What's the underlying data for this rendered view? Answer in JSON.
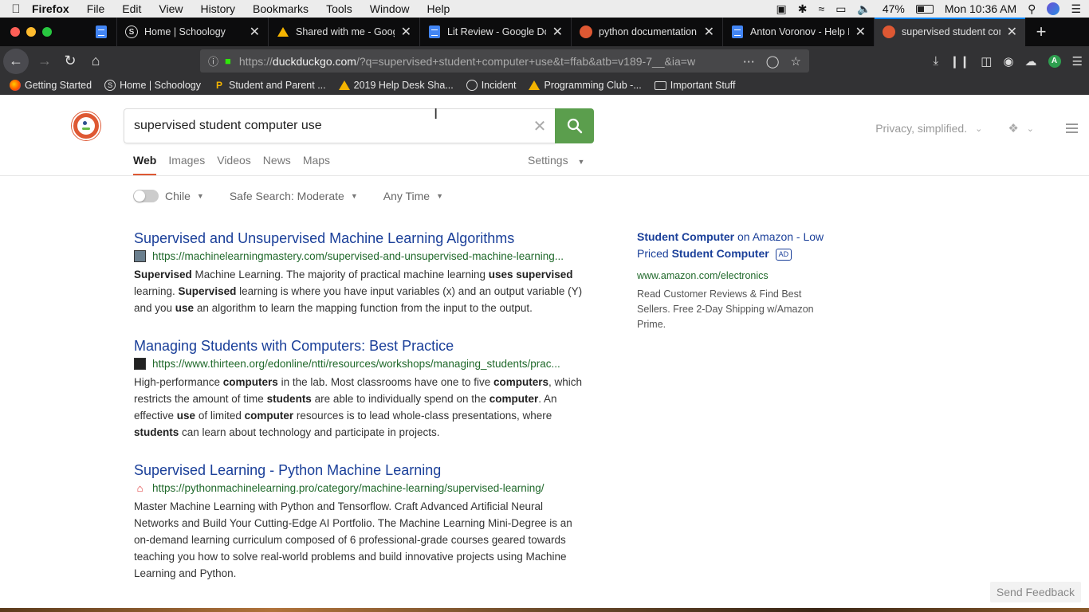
{
  "menubar": {
    "app": "Firefox",
    "items": [
      "File",
      "Edit",
      "View",
      "History",
      "Bookmarks",
      "Tools",
      "Window",
      "Help"
    ],
    "battery": "47%",
    "battery_level": 0.47,
    "clock": "Mon 10:36 AM"
  },
  "tabs": [
    {
      "title": "Home | Schoology",
      "icon": "schoology-icon"
    },
    {
      "title": "Shared with me - Google",
      "icon": "google-drive-icon"
    },
    {
      "title": "Lit Review - Google Docs",
      "icon": "google-docs-icon"
    },
    {
      "title": "python documentation at",
      "icon": "duckduckgo-icon"
    },
    {
      "title": "Anton Voronov - Help De",
      "icon": "google-docs-icon"
    },
    {
      "title": "supervised student comp",
      "icon": "duckduckgo-icon",
      "active": true
    }
  ],
  "urlbar": {
    "prefix": "https://",
    "domain": "duckduckgo.com",
    "rest": "/?q=supervised+student+computer+use&t=ffab&atb=v189-7__&ia=w"
  },
  "account_initial": "A",
  "bookmarks": [
    {
      "label": "Getting Started",
      "icon": "firefox-icon"
    },
    {
      "label": "Home | Schoology",
      "icon": "schoology-icon"
    },
    {
      "label": "Student and Parent ...",
      "icon": "bookmark-icon"
    },
    {
      "label": "2019 Help Desk Sha...",
      "icon": "google-drive-icon"
    },
    {
      "label": "Incident",
      "icon": "globe-icon"
    },
    {
      "label": "Programming Club -...",
      "icon": "google-drive-icon"
    },
    {
      "label": "Important Stuff",
      "icon": "folder-icon"
    }
  ],
  "search": {
    "query": "supervised student computer use"
  },
  "header": {
    "tagline": "Privacy, simplified."
  },
  "verticals": [
    "Web",
    "Images",
    "Videos",
    "News",
    "Maps"
  ],
  "settings_label": "Settings",
  "filters": {
    "region": "Chile",
    "safe_search": "Safe Search: Moderate",
    "time": "Any Time"
  },
  "results": [
    {
      "title": "Supervised and Unsupervised Machine Learning Algorithms",
      "url": "https://machinelearningmastery.com/supervised-and-unsupervised-machine-learning...",
      "snippet_parts": [
        {
          "t": "Supervised",
          "b": true
        },
        {
          "t": " Machine Learning. The majority of practical machine learning "
        },
        {
          "t": "uses supervised",
          "b": true
        },
        {
          "t": " learning. "
        },
        {
          "t": "Supervised",
          "b": true
        },
        {
          "t": " learning is where you have input variables (x) and an output variable (Y) and you "
        },
        {
          "t": "use",
          "b": true
        },
        {
          "t": " an algorithm to learn the mapping function from the input to the output."
        }
      ]
    },
    {
      "title": "Managing Students with Computers: Best Practice",
      "url": "https://www.thirteen.org/edonline/ntti/resources/workshops/managing_students/prac...",
      "snippet_parts": [
        {
          "t": "High-performance "
        },
        {
          "t": "computers",
          "b": true
        },
        {
          "t": " in the lab. Most classrooms have one to five "
        },
        {
          "t": "computers",
          "b": true
        },
        {
          "t": ", which restricts the amount of time "
        },
        {
          "t": "students",
          "b": true
        },
        {
          "t": " are able to individually spend on the "
        },
        {
          "t": "computer",
          "b": true
        },
        {
          "t": ". An effective "
        },
        {
          "t": "use",
          "b": true
        },
        {
          "t": " of limited "
        },
        {
          "t": "computer",
          "b": true
        },
        {
          "t": " resources is to lead whole-class presentations, where "
        },
        {
          "t": "students",
          "b": true
        },
        {
          "t": " can learn about technology and participate in projects."
        }
      ]
    },
    {
      "title": "Supervised Learning - Python Machine Learning",
      "url": "https://pythonmachinelearning.pro/category/machine-learning/supervised-learning/",
      "snippet_parts": [
        {
          "t": "Master Machine Learning with Python and Tensorflow. Craft Advanced Artificial Neural Networks and Build Your Cutting-Edge AI Portfolio. The Machine Learning Mini-Degree is an on-demand learning curriculum composed of 6 professional-grade courses geared towards teaching you how to solve real-world problems and build innovative projects using Machine Learning and Python."
        }
      ]
    }
  ],
  "ad": {
    "title_parts": [
      {
        "t": "Student Computer",
        "b": true
      },
      {
        "t": " on Amazon - Low Priced "
      },
      {
        "t": "Student Computer",
        "b": true
      }
    ],
    "badge": "AD",
    "url": "www.amazon.com/electronics",
    "snippet": "Read Customer Reviews & Find Best Sellers. Free 2-Day Shipping w/Amazon Prime."
  },
  "feedback_label": "Send Feedback"
}
